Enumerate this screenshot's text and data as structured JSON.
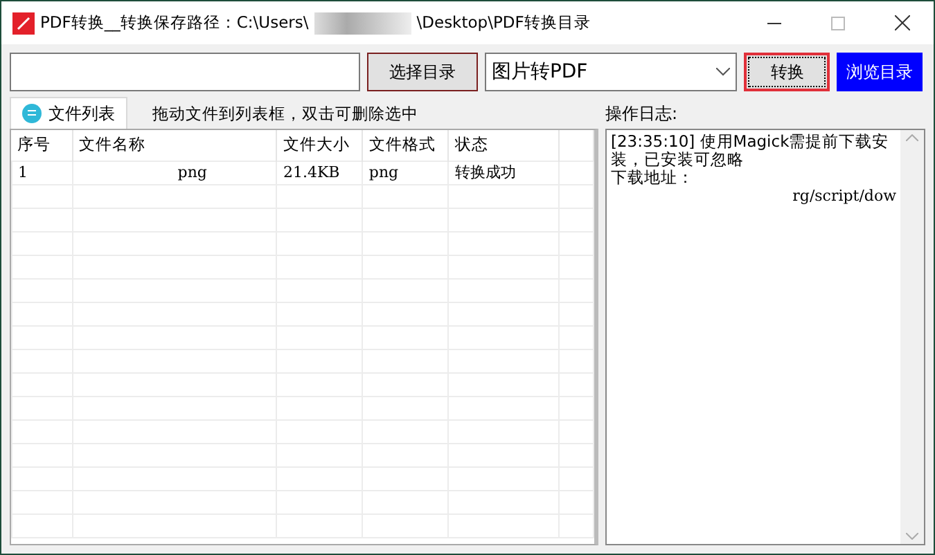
{
  "window": {
    "title_start": "PDF转换__转换保存路径：C:\\Users\\",
    "title_end": "\\Desktop\\PDF转换目录"
  },
  "toolbar": {
    "choose_button": "选择目录",
    "mode_select": {
      "value": "图片转PDF"
    },
    "convert_button": "转换",
    "browse_button": "浏览目录"
  },
  "tabs": [
    {
      "label": "文件列表",
      "selected": true
    }
  ],
  "hint": "拖动文件到列表框，双击可删除选中",
  "table": {
    "columns": [
      "序号",
      "文件名称",
      "文件大小",
      "文件格式",
      "状态"
    ],
    "rows": [
      {
        "cells": [
          "1",
          "png",
          "21.4KB",
          "png",
          "转换成功"
        ]
      }
    ]
  },
  "log": {
    "title": "操作日志:",
    "lines": [
      "[23:35:10] 使用Magick需提前下载安装，已安装可忽略",
      "下载地址：",
      "rg/script/dow"
    ]
  }
}
